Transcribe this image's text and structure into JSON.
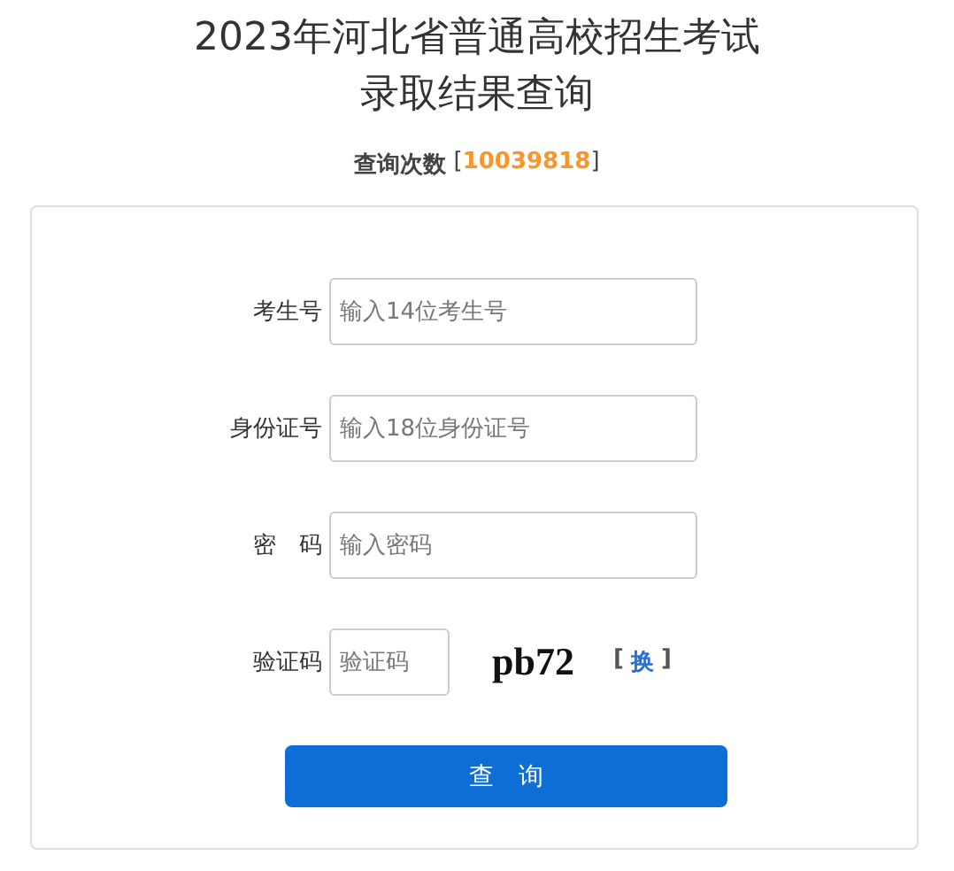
{
  "title_lines": [
    "2023年河北省普通高校招生考试",
    "录取结果查询"
  ],
  "query_count": {
    "label": "查询次数",
    "open": "[",
    "value": "10039818",
    "close": "]"
  },
  "fields": [
    {
      "label": "考生号",
      "placeholder": "输入14位考生号",
      "kind": "text"
    },
    {
      "label": "身份证号",
      "placeholder": "输入18位身份证号",
      "kind": "text"
    },
    {
      "label": "密　码",
      "placeholder": "输入密码",
      "kind": "password"
    },
    {
      "label": "验证码",
      "placeholder": "验证码",
      "kind": "captcha",
      "captcha": "pb72",
      "refresh_open": "[",
      "refresh": "换",
      "refresh_close": "]"
    }
  ],
  "submit": "查　询"
}
